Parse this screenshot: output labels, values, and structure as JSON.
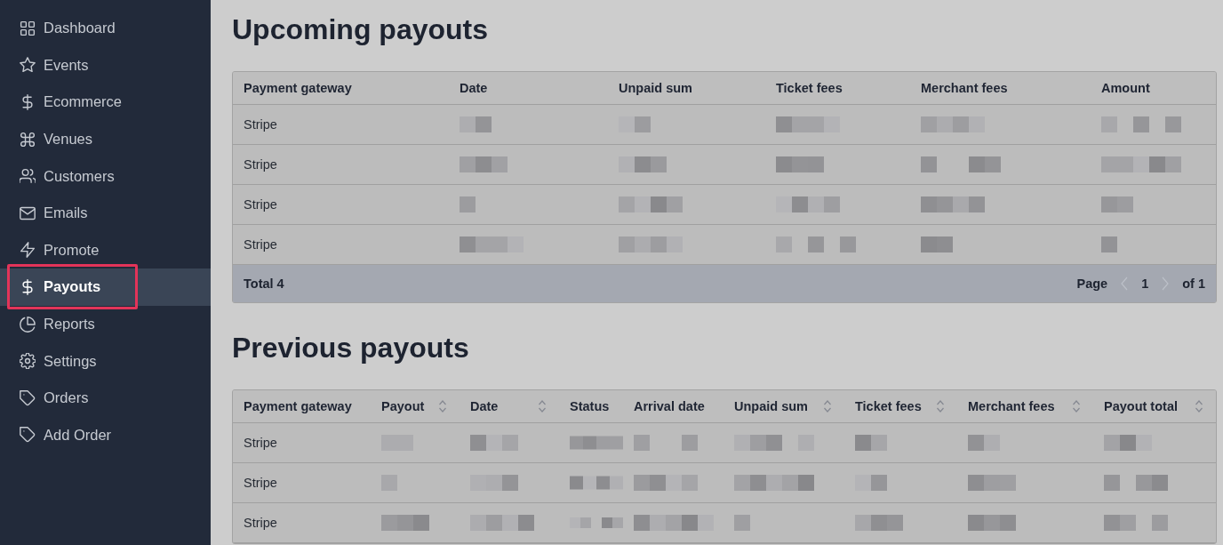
{
  "sidebar": {
    "items": [
      {
        "label": "Dashboard",
        "selected": false,
        "highlighted": false
      },
      {
        "label": "Events",
        "selected": false,
        "highlighted": false
      },
      {
        "label": "Ecommerce",
        "selected": false,
        "highlighted": false
      },
      {
        "label": "Venues",
        "selected": false,
        "highlighted": false
      },
      {
        "label": "Customers",
        "selected": false,
        "highlighted": false
      },
      {
        "label": "Emails",
        "selected": false,
        "highlighted": false
      },
      {
        "label": "Promote",
        "selected": false,
        "highlighted": false
      },
      {
        "label": "Payouts",
        "selected": true,
        "highlighted": true
      },
      {
        "label": "Reports",
        "selected": false,
        "highlighted": false
      },
      {
        "label": "Settings",
        "selected": false,
        "highlighted": false
      },
      {
        "label": "Orders",
        "selected": false,
        "highlighted": false
      },
      {
        "label": "Add Order",
        "selected": false,
        "highlighted": false
      }
    ]
  },
  "upcoming_payouts": {
    "title": "Upcoming payouts",
    "columns": [
      {
        "label": "Payment gateway",
        "sortable": false
      },
      {
        "label": "Date",
        "sortable": false
      },
      {
        "label": "Unpaid sum",
        "sortable": false
      },
      {
        "label": "Ticket fees",
        "sortable": false
      },
      {
        "label": "Merchant fees",
        "sortable": false
      },
      {
        "label": "Amount",
        "sortable": false
      }
    ],
    "rows": [
      {
        "payment_gateway": "Stripe"
      },
      {
        "payment_gateway": "Stripe"
      },
      {
        "payment_gateway": "Stripe"
      },
      {
        "payment_gateway": "Stripe"
      }
    ],
    "footer": {
      "total": "Total 4",
      "pagination": {
        "label": "Page",
        "current": "1",
        "of": "of 1",
        "previous_disabled": true,
        "next_disabled": true
      }
    }
  },
  "previous_payouts": {
    "title": "Previous payouts",
    "columns": [
      {
        "label": "Payment gateway",
        "sortable": false
      },
      {
        "label": "Payout",
        "sortable": true
      },
      {
        "label": "Date",
        "sortable": true
      },
      {
        "label": "Status",
        "sortable": false
      },
      {
        "label": "Arrival date",
        "sortable": false
      },
      {
        "label": "Unpaid sum",
        "sortable": true
      },
      {
        "label": "Ticket fees",
        "sortable": true
      },
      {
        "label": "Merchant fees",
        "sortable": true
      },
      {
        "label": "Payout total",
        "sortable": true
      }
    ],
    "rows": [
      {
        "payment_gateway": "Stripe"
      },
      {
        "payment_gateway": "Stripe"
      },
      {
        "payment_gateway": "Stripe"
      }
    ]
  }
}
